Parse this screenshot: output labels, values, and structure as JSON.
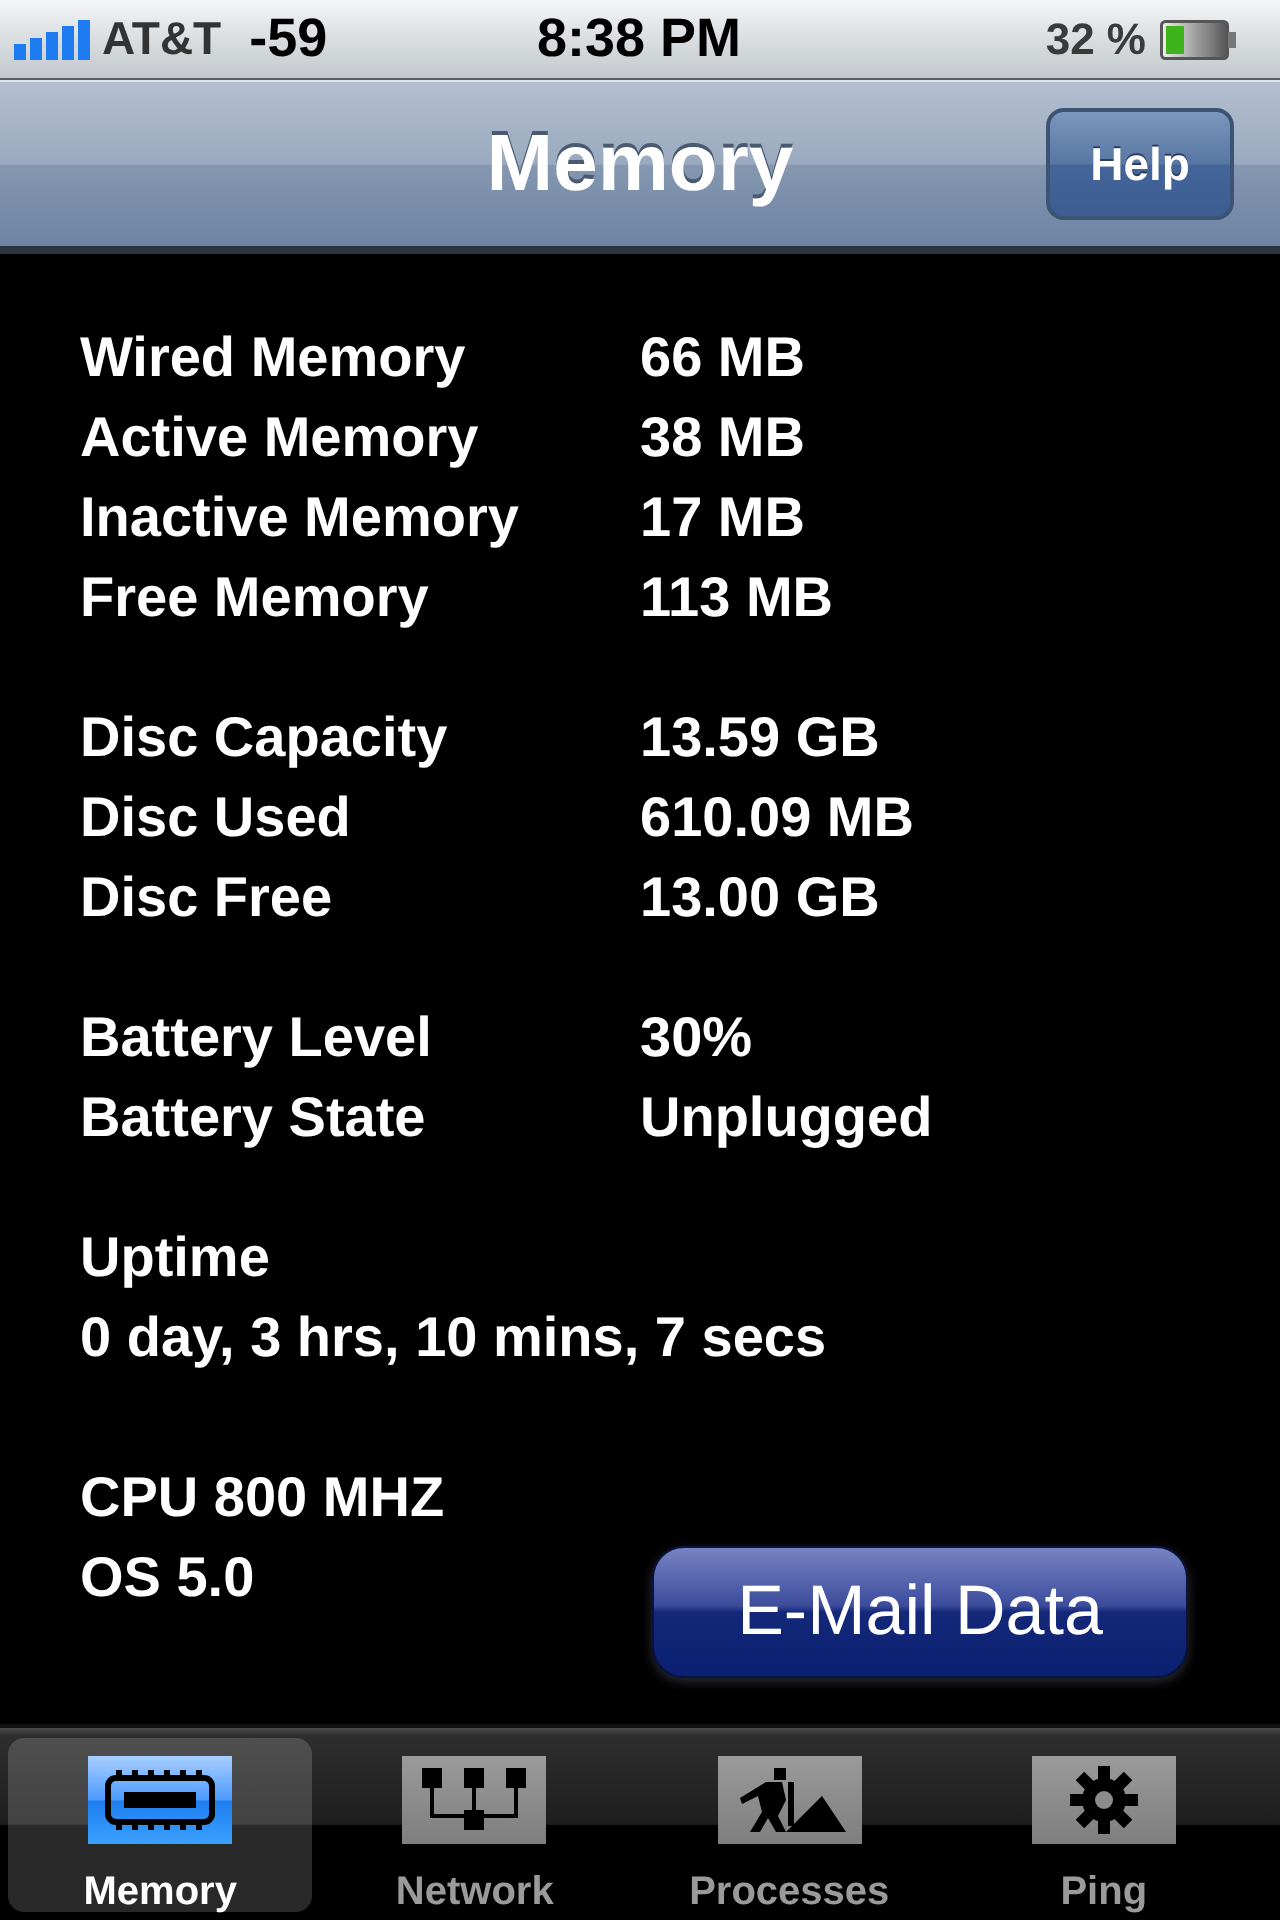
{
  "status_bar": {
    "carrier": "AT&T",
    "signal_reading": "-59",
    "time": "8:38 PM",
    "battery_percent": "32 %"
  },
  "nav_bar": {
    "title": "Memory",
    "help_button": "Help"
  },
  "sections": [
    {
      "rows": [
        {
          "kind": "pair",
          "label": "Wired Memory",
          "value": "66 MB"
        },
        {
          "kind": "pair",
          "label": "Active Memory",
          "value": "38 MB"
        },
        {
          "kind": "pair",
          "label": "Inactive Memory",
          "value": "17 MB"
        },
        {
          "kind": "pair",
          "label": "Free Memory",
          "value": "113 MB"
        }
      ]
    },
    {
      "rows": [
        {
          "kind": "pair",
          "label": "Disc Capacity",
          "value": "13.59 GB"
        },
        {
          "kind": "pair",
          "label": "Disc Used",
          "value": "610.09 MB"
        },
        {
          "kind": "pair",
          "label": "Disc Free",
          "value": "13.00 GB"
        }
      ]
    },
    {
      "rows": [
        {
          "kind": "pair",
          "label": "Battery Level",
          "value": "30%"
        },
        {
          "kind": "pair",
          "label": "Battery State",
          "value": "Unplugged"
        }
      ]
    },
    {
      "rows": [
        {
          "kind": "line",
          "text": "Uptime"
        },
        {
          "kind": "line",
          "text": "0 day, 3 hrs, 10 mins, 7 secs"
        }
      ]
    },
    {
      "rows": [
        {
          "kind": "line",
          "text": "CPU 800 MHZ"
        },
        {
          "kind": "line",
          "text": "OS 5.0"
        }
      ],
      "button": "E-Mail Data"
    }
  ],
  "tabs": [
    {
      "label": "Memory",
      "selected": true
    },
    {
      "label": "Network",
      "selected": false
    },
    {
      "label": "Processes",
      "selected": false
    },
    {
      "label": "Ping",
      "selected": false
    }
  ]
}
